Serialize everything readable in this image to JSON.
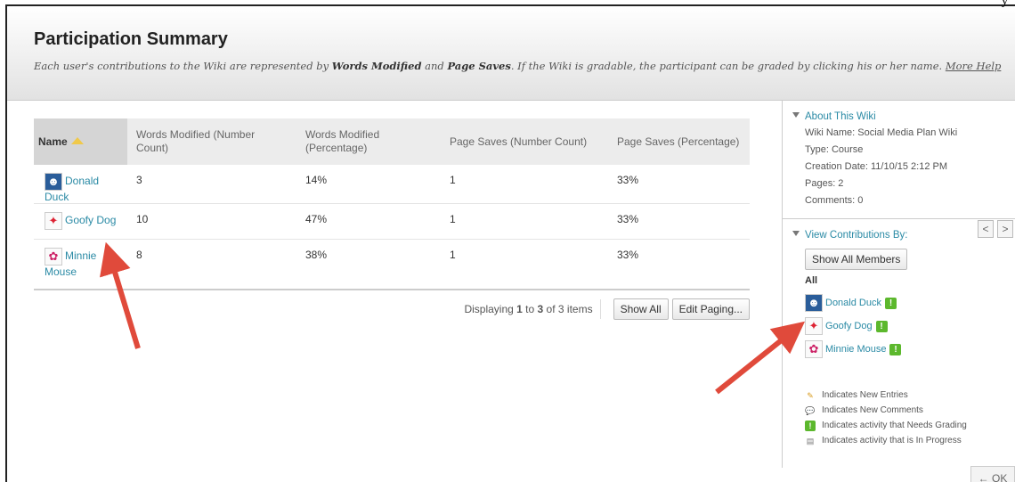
{
  "corner_text": "y",
  "header": {
    "title": "Participation Summary",
    "description_parts": [
      "Each user's contributions to the Wiki are represented by ",
      "Words Modified",
      " and ",
      "Page Saves",
      ". If the Wiki is gradable, the participant can be graded by clicking his or her name. "
    ],
    "help_link": "More Help"
  },
  "table": {
    "columns": [
      "Name",
      "Words Modified (Number Count)",
      "Words Modified (Percentage)",
      "Page Saves (Number Count)",
      "Page Saves (Percentage)"
    ],
    "rows": [
      {
        "name": "Donald Duck",
        "avatar": "donald-avatar",
        "words_count": "3",
        "words_pct": "14%",
        "saves_count": "1",
        "saves_pct": "33%"
      },
      {
        "name": "Goofy Dog",
        "avatar": "goofy-avatar",
        "words_count": "10",
        "words_pct": "47%",
        "saves_count": "1",
        "saves_pct": "33%"
      },
      {
        "name": "Minnie Mouse",
        "avatar": "minnie-avatar",
        "words_count": "8",
        "words_pct": "38%",
        "saves_count": "1",
        "saves_pct": "33%"
      }
    ]
  },
  "paging": {
    "display_prefix": "Displaying ",
    "display_from": "1",
    "display_mid": " to ",
    "display_to": "3",
    "display_suffix": " of 3 items",
    "show_all": "Show All",
    "edit_paging": "Edit Paging..."
  },
  "sidebar": {
    "about": {
      "title": "About This Wiki",
      "lines": [
        "Wiki Name: Social Media Plan Wiki",
        "Type: Course",
        "Creation Date: 11/10/15 2:12 PM",
        "Pages: 2",
        "Comments: 0"
      ]
    },
    "contributions": {
      "title": "View Contributions By:",
      "show_all_members": "Show All Members",
      "all_label": "All",
      "members": [
        "Donald Duck",
        "Goofy Dog",
        "Minnie Mouse"
      ]
    },
    "legend": [
      {
        "icon": "new-entries-icon",
        "text": "Indicates New Entries"
      },
      {
        "icon": "new-comments-icon",
        "text": "Indicates New Comments"
      },
      {
        "icon": "needs-grading-icon",
        "text": "Indicates activity that Needs Grading"
      },
      {
        "icon": "in-progress-icon",
        "text": "Indicates activity that is In Progress"
      }
    ],
    "nav_prev": "<",
    "nav_next": ">"
  },
  "ok_button": "← OK",
  "colors": {
    "link": "#2a8aa5",
    "grade_flag": "#5cb82d",
    "annotation_arrow": "#e04a3b"
  }
}
